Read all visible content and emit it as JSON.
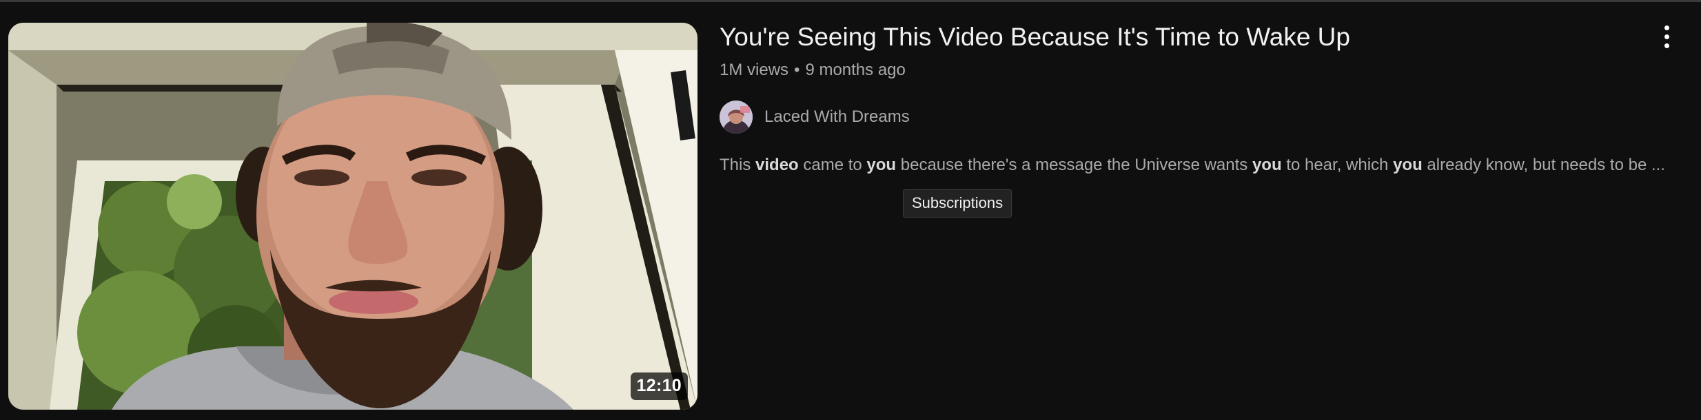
{
  "video": {
    "title": "You're Seeing This Video Because It's Time to Wake Up",
    "views": "1M views",
    "separator": "•",
    "age": "9 months ago",
    "duration": "12:10",
    "channel": "Laced With Dreams",
    "description_parts": [
      {
        "text": "This ",
        "bold": false
      },
      {
        "text": "video",
        "bold": true
      },
      {
        "text": " came to ",
        "bold": false
      },
      {
        "text": "you",
        "bold": true
      },
      {
        "text": " because there's a message the Universe wants ",
        "bold": false
      },
      {
        "text": "you",
        "bold": true
      },
      {
        "text": " to hear, which ",
        "bold": false
      },
      {
        "text": "you",
        "bold": true
      },
      {
        "text": " already know, but needs to be ...",
        "bold": false
      }
    ]
  },
  "tooltip": {
    "text": "Subscriptions"
  },
  "icons": {
    "more": "more-vert-icon"
  },
  "colors": {
    "background": "#0f0f0f",
    "title": "#f1f1f1",
    "secondary_text": "#aaaaaa"
  }
}
